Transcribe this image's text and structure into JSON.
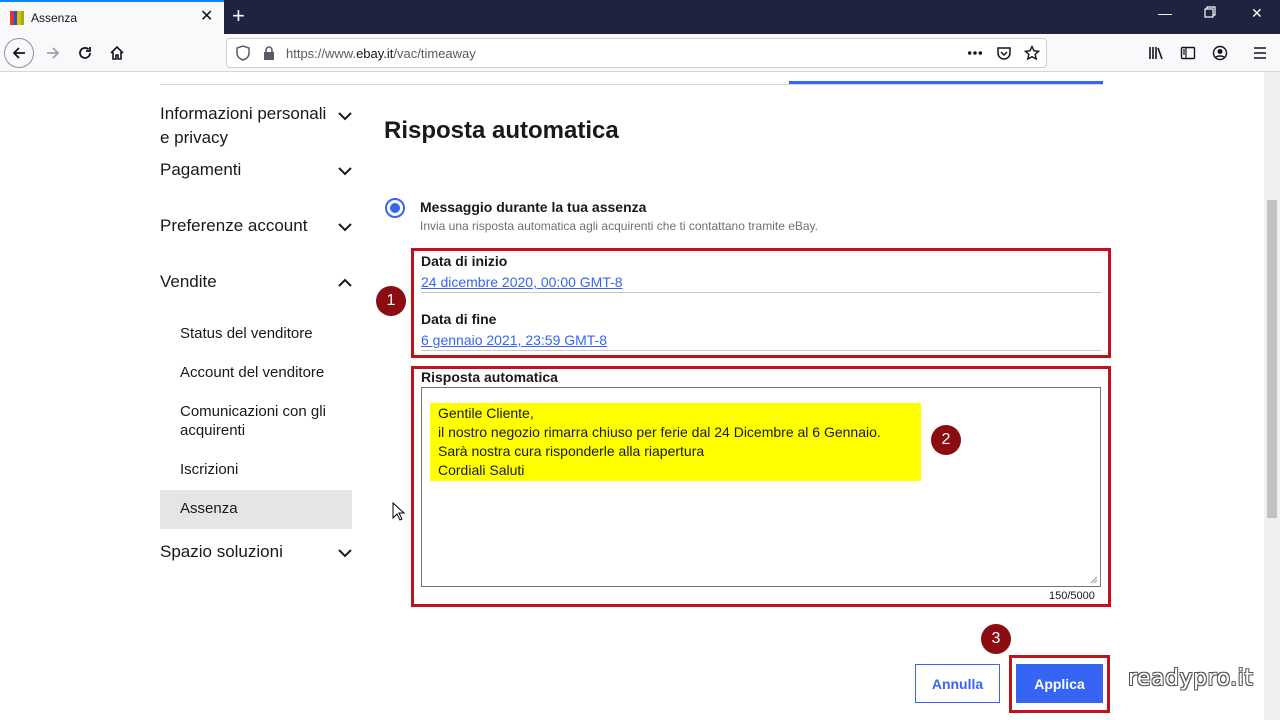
{
  "browser": {
    "tab_title": "Assenza",
    "url_prefix": "https://www.",
    "url_domain": "ebay.it",
    "url_path": "/vac/timeaway",
    "accent_color": "#0a84ff",
    "icons": [
      "back-icon",
      "forward-icon",
      "reload-icon",
      "home-icon",
      "shield-icon",
      "lock-icon",
      "more-icon",
      "pocket-icon",
      "bookmark-star-icon",
      "library-icon",
      "sidebar-icon",
      "account-icon",
      "menu-icon"
    ]
  },
  "sidebar": {
    "items": [
      {
        "label_line1": "Informazioni personali",
        "label_line2": "e privacy",
        "expanded": false
      },
      {
        "label": "Pagamenti",
        "expanded": false
      },
      {
        "label": "Preferenze account",
        "expanded": false
      },
      {
        "label": "Vendite",
        "expanded": true
      },
      {
        "label": "Spazio soluzioni",
        "expanded": false
      }
    ],
    "sub_items": [
      {
        "label": "Status del venditore"
      },
      {
        "label": "Account del venditore"
      },
      {
        "label_line1": "Comunicazioni con gli",
        "label_line2": "acquirenti"
      },
      {
        "label": "Iscrizioni"
      },
      {
        "label": "Assenza",
        "active": true
      }
    ]
  },
  "main": {
    "title": "Risposta automatica",
    "option": {
      "title": "Messaggio durante la tua assenza",
      "subtitle": "Invia una risposta automatica agli acquirenti che ti contattano tramite eBay.",
      "selected": true
    },
    "start_label": "Data di inizio",
    "start_value": "24 dicembre 2020, 00:00 GMT-8",
    "end_label": "Data di fine",
    "end_value": "6 gennaio 2021, 23:59 GMT-8",
    "reply_label": "Risposta automatica",
    "message_lines": [
      "Gentile Cliente,",
      "il nostro negozio rimarra chiuso per ferie dal 24 Dicembre al 6 Gennaio.",
      "Sarà nostra cura risponderle alla riapertura",
      "Cordiali Saluti"
    ],
    "counter": "150/5000",
    "cancel_label": "Annulla",
    "apply_label": "Applica",
    "accent_color": "#3665f3"
  },
  "annotations": {
    "badges": [
      "1",
      "2",
      "3"
    ],
    "box_color": "#c1121c",
    "highlight_color": "#ffff00"
  },
  "watermark": "readypro.it"
}
